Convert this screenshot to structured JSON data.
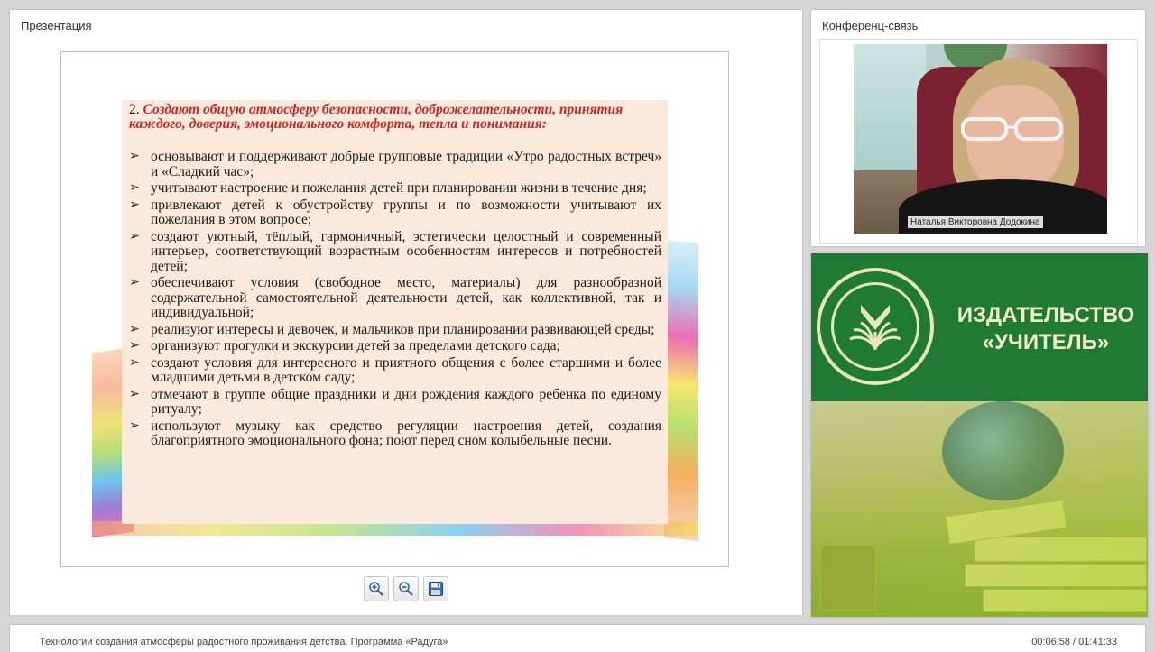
{
  "presentation": {
    "title": "Презентация",
    "slide": {
      "heading_number": "2.",
      "heading": "Создают общую атмосферу безопасности, доброжелательности, принятия каждого, доверия, эмоционального комфорта, тепла и понимания:",
      "bullets": [
        "основывают и поддерживают добрые групповые традиции «Утро радостных встреч» и «Сладкий час»;",
        "учитывают настроение и пожелания детей при планировании жизни в течение дня;",
        "привлекают детей к обустройству группы и по возможности учитывают их пожелания в этом вопросе;",
        "создают уютный, тёплый, гармоничный, эстетически целостный и современный интерьер, соответствующий возрастным особенностям интересов и потребностей детей;",
        "обеспечивают условия (свободное место, материалы) для разнообразной содержательной самостоятельной деятельности детей, как коллективной, так и индивидуальной;",
        "реализуют интересы и девочек, и мальчиков при планировании развивающей среды;",
        "организуют прогулки и экскурсии детей за пределами детского сада;",
        "создают условия для интересного и приятного общения с более старшими и более младшими детьми в детском саду;",
        "отмечают в группе общие праздники и дни рождения каждого ребёнка по единому ритуалу;",
        "используют музыку как средство регуляции настроения детей, создания благоприятного эмоционального фона; поют перед сном колыбельные песни."
      ],
      "bullet_symbol": "➢"
    },
    "toolbar": {
      "zoom_in_icon": "zoom-in-icon",
      "zoom_out_icon": "zoom-out-icon",
      "save_icon": "save-icon"
    }
  },
  "conference": {
    "title": "Конференц-связь",
    "speaker_name": "Наталья Викторовна Додокина"
  },
  "banner": {
    "line1": "ИЗДАТЕЛЬСТВО",
    "line2": "«УЧИТЕЛЬ»"
  },
  "footer": {
    "title": "Технологии создания атмосферы радостного проживания детства. Программа «Радуга»",
    "time": "00:06:58 / 01:41:33"
  }
}
